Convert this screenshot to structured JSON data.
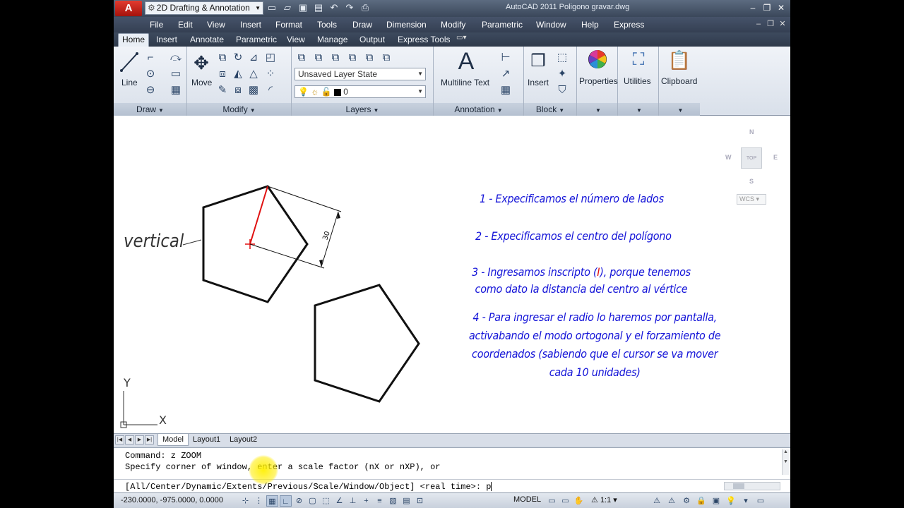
{
  "titlebar": {
    "logo": "A",
    "workspace": "2D Drafting & Annotation",
    "title": "AutoCAD 2011    Poligono gravar.dwg",
    "qat_icons": [
      "new-icon",
      "open-icon",
      "save-icon",
      "save-as-icon",
      "undo-icon",
      "redo-icon",
      "plot-icon"
    ]
  },
  "menu": [
    "File",
    "Edit",
    "View",
    "Insert",
    "Format",
    "Tools",
    "Draw",
    "Dimension",
    "Modify",
    "Parametric",
    "Window",
    "Help",
    "Express"
  ],
  "ribbon_tabs": [
    "Home",
    "Insert",
    "Annotate",
    "Parametric",
    "View",
    "Manage",
    "Output",
    "Express Tools"
  ],
  "panels": {
    "draw": {
      "title": "Draw",
      "line_label": "Line"
    },
    "modify": {
      "title": "Modify",
      "move_label": "Move"
    },
    "layers": {
      "title": "Layers",
      "layer_state": "Unsaved Layer State",
      "current_layer": "0"
    },
    "annotation": {
      "title": "Annotation",
      "mtext_label": "Multiline Text",
      "mtext_glyph": "A"
    },
    "block": {
      "title": "Block",
      "insert_label": "Insert"
    },
    "properties": {
      "label": "Properties"
    },
    "utilities": {
      "label": "Utilities"
    },
    "clipboard": {
      "label": "Clipboard"
    }
  },
  "drawing": {
    "label_vertical": "vertical",
    "dimension": "30",
    "notes": [
      [
        "1 - Expecificamos el número de lados"
      ],
      [
        "2 - Expecificamos el centro del polígono"
      ],
      [
        "3 - Ingresamos inscripto (",
        "I",
        "), porque tenemos",
        "como dato la distancia del centro al vértice"
      ],
      [
        "4 - Para ingresar el radio lo haremos por pantalla,",
        "activabando el modo ortogonal y el forzamiento de",
        "coordenados (sabiendo que el cursor se va mover",
        "cada 10 unidades)"
      ]
    ],
    "colors": {
      "notes": "#1414d8",
      "radius": "#e01010",
      "accent": "#e01010"
    },
    "axis_y": "Y",
    "axis_x": "X",
    "viewcube": {
      "n": "N",
      "s": "S",
      "e": "E",
      "w": "W",
      "top": "TOP",
      "wcs": "WCS"
    }
  },
  "layout_tabs": [
    "Model",
    "Layout1",
    "Layout2"
  ],
  "command": {
    "line1": "Command: z ZOOM",
    "line2": "Specify corner of window, enter a scale factor (nX or nXP), or",
    "prompt": "[All/Center/Dynamic/Extents/Previous/Scale/Window/Object] <real time>: p"
  },
  "status": {
    "coords": "-230.0000, -975.0000, 0.0000",
    "model": "MODEL",
    "scale": "1:1"
  }
}
